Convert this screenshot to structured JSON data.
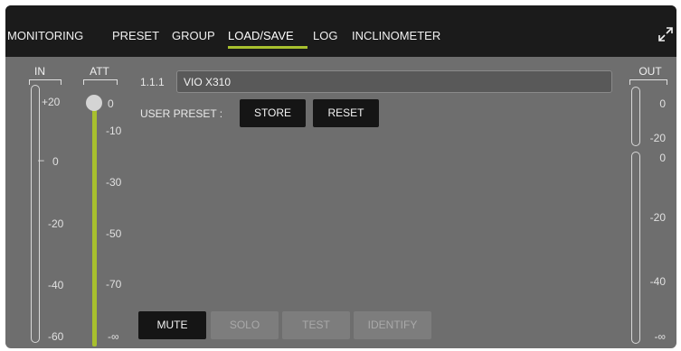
{
  "tabs": [
    {
      "label": "MONITORING"
    },
    {
      "label": "PRESET"
    },
    {
      "label": "GROUP"
    },
    {
      "label": "LOAD/SAVE",
      "active": true
    },
    {
      "label": "LOG"
    },
    {
      "label": "INCLINOMETER"
    }
  ],
  "colors": {
    "accent": "#a8c02e",
    "panel": "#6e6e6e",
    "topbar": "#1b1b1b"
  },
  "input_meter": {
    "header": "IN",
    "ticks": [
      "+20",
      "0",
      "-20",
      "-40",
      "-60"
    ]
  },
  "att": {
    "header": "ATT",
    "ticks": [
      "0",
      "-10",
      "-30",
      "-50",
      "-70",
      "-∞"
    ],
    "level": 0
  },
  "device": {
    "id": "1.1.1",
    "name": "VIO X310"
  },
  "user_preset": {
    "label": "USER PRESET :",
    "store": "STORE",
    "reset": "RESET"
  },
  "channel_buttons": {
    "mute": "MUTE",
    "solo": "SOLO",
    "test": "TEST",
    "identify": "IDENTIFY"
  },
  "output_meter": {
    "header": "OUT",
    "top_ticks": [
      "0",
      "-20"
    ],
    "ticks": [
      "0",
      "-20",
      "-40",
      "-∞"
    ]
  },
  "icons": {
    "expand": "expand-icon"
  }
}
